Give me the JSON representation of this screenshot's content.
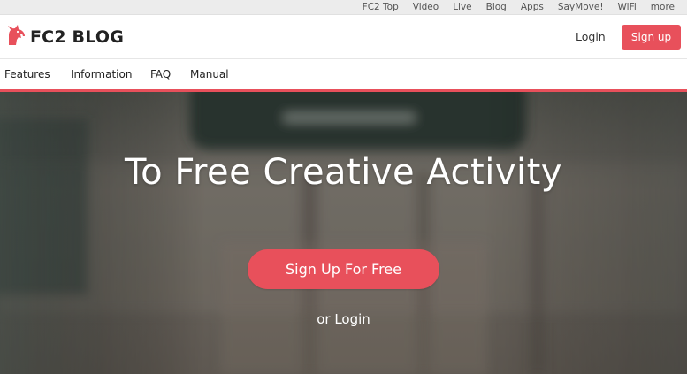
{
  "topbar": {
    "links": [
      "FC2 Top",
      "Video",
      "Live",
      "Blog",
      "Apps",
      "SayMove!",
      "WiFi",
      "more"
    ]
  },
  "header": {
    "logo_text": "FC2 BLOG",
    "login_label": "Login",
    "signup_label": "Sign up"
  },
  "nav": {
    "items": [
      "Features",
      "Information",
      "FAQ",
      "Manual"
    ]
  },
  "hero": {
    "title": "To Free Creative Activity",
    "cta_label": "Sign Up For Free",
    "login_label": "or Login"
  },
  "colors": {
    "accent": "#e8505b",
    "topbar_bg": "#ececec"
  },
  "icons": {
    "logo": "fc2-unicorn-logo-icon"
  }
}
